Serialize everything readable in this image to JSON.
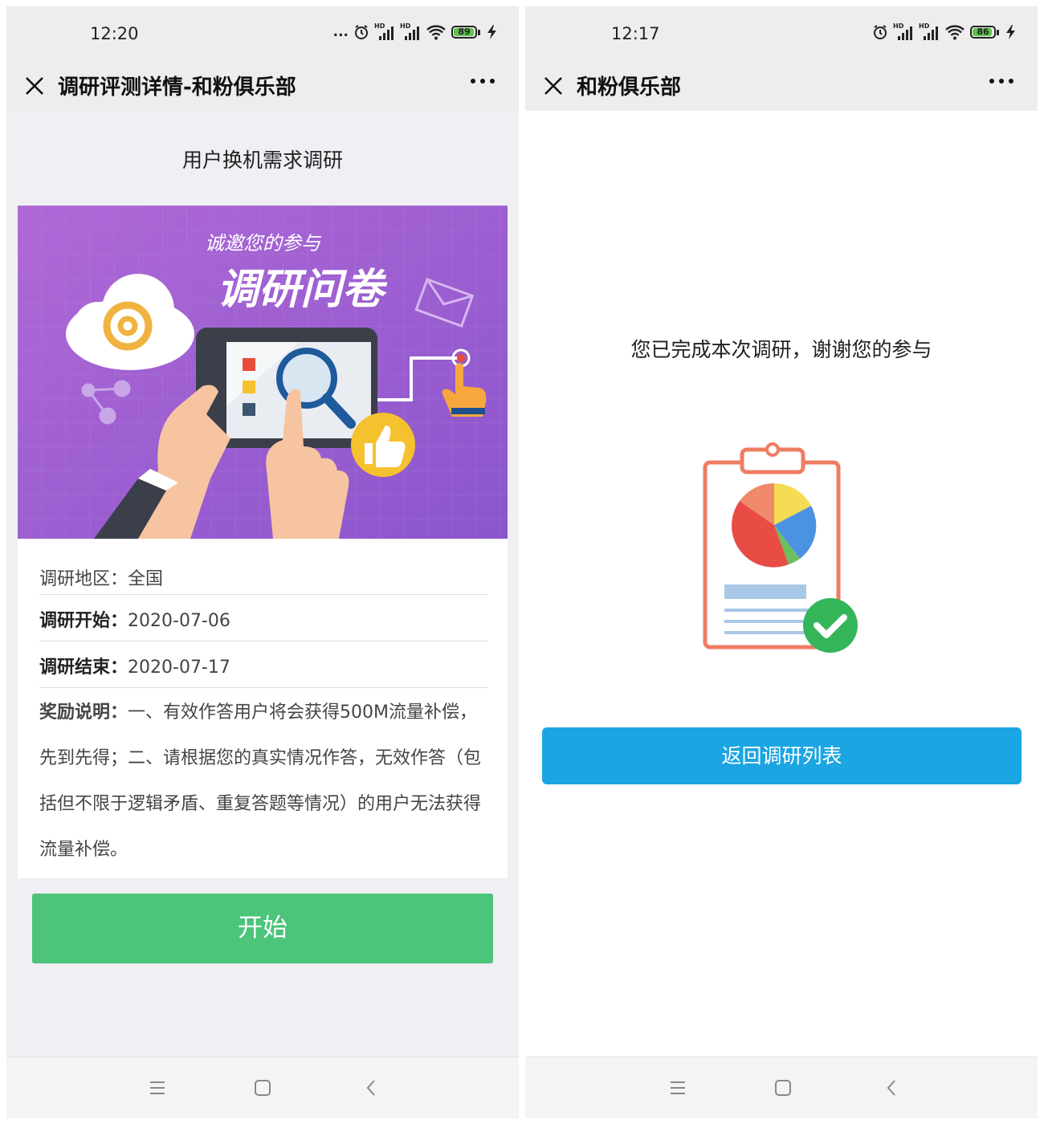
{
  "left_screen": {
    "status_bar": {
      "time": "12:20",
      "dots": "...",
      "battery": "89"
    },
    "nav": {
      "title": "调研评测详情-和粉俱乐部"
    },
    "survey_title": "用户换机需求调研",
    "banner": {
      "subtitle": "诚邀您的参与",
      "title": "调研问卷"
    },
    "info": {
      "region_label": "调研地区：",
      "region_value": "全国",
      "start_label": "调研开始：",
      "start_value": "2020-07-06",
      "end_label": "调研结束：",
      "end_value": "2020-07-17",
      "reward_label": "奖励说明：",
      "reward_text": "一、有效作答用户将会获得500M流量补偿，先到先得；二、请根据您的真实情况作答，无效作答（包括但不限于逻辑矛盾、重复答题等情况）的用户无法获得流量补偿。"
    },
    "start_button": "开始"
  },
  "right_screen": {
    "status_bar": {
      "time": "12:17",
      "battery": "86"
    },
    "nav": {
      "title": "和粉俱乐部"
    },
    "done_message": "您已完成本次调研，谢谢您的参与",
    "back_button": "返回调研列表"
  },
  "colors": {
    "start_green": "#4cc47a",
    "back_blue": "#1ba5e2",
    "battery_green": "#5ec24b",
    "banner_purple": "#a45fd0"
  }
}
